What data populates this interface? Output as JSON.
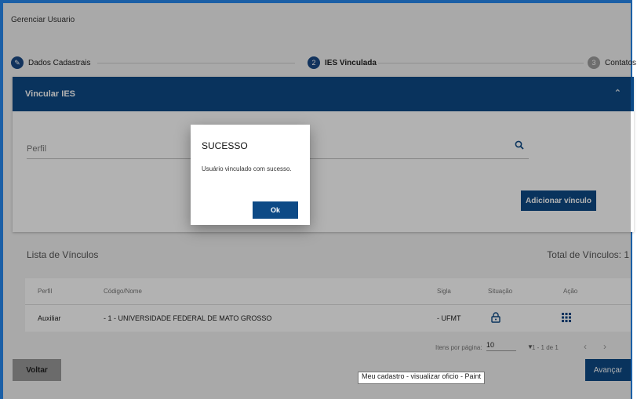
{
  "page": {
    "title": "Gerenciar Usuario"
  },
  "stepper": {
    "steps": [
      {
        "label": "Dados Cadastrais",
        "marker": "✎"
      },
      {
        "label": "IES Vinculada",
        "marker": "2"
      },
      {
        "label": "Contatos",
        "marker": "3"
      }
    ]
  },
  "section": {
    "title": "Vincular IES",
    "perfil_placeholder": "Perfil",
    "add_button": "Adicionar vínculo"
  },
  "list": {
    "title": "Lista de Vínculos",
    "total": "Total de Vínculos:  1",
    "headers": [
      "Perfil",
      "Código/Nome",
      "Sigla",
      "Situação",
      "Ação"
    ],
    "rows": [
      {
        "perfil": "Auxiliar",
        "nome": "- 1 - UNIVERSIDADE FEDERAL DE MATO GROSSO",
        "sigla": "- UFMT"
      }
    ]
  },
  "pager": {
    "items_label": "Itens por página:",
    "per_page": "10",
    "range": "1 - 1 de 1"
  },
  "footer": {
    "back": "Voltar",
    "next": "Avançar",
    "tooltip": "Meu cadastro - visualizar oficio - Paint"
  },
  "dialog": {
    "title": "SUCESSO",
    "message": "Usuário vinculado com sucesso.",
    "ok": "Ok"
  },
  "colors": {
    "primary": "#0d4a86",
    "frame": "#1b5fa6"
  }
}
